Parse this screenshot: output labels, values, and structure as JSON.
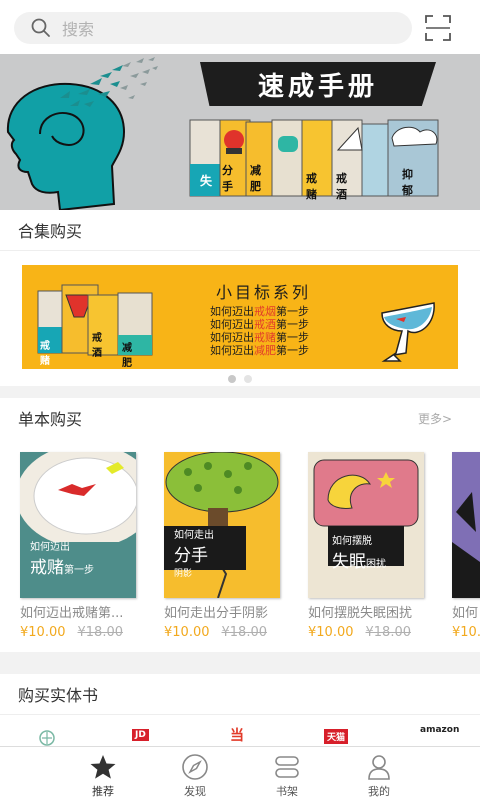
{
  "search": {
    "placeholder": "搜索",
    "icon": "search-icon"
  },
  "scan": {
    "icon": "scan-icon"
  },
  "hero": {
    "title": "速成手册",
    "book_labels": [
      "失",
      "分手",
      "减肥",
      "戒赌",
      "戒酒",
      "抑郁"
    ]
  },
  "collection": {
    "header": "合集购买",
    "banner": {
      "series_title": "小目标系列",
      "lines": [
        {
          "a": "如何迈出",
          "hl": "戒烟",
          "b": "第一步"
        },
        {
          "a": "如何迈出",
          "hl": "戒酒",
          "b": "第一步"
        },
        {
          "a": "如何迈出",
          "hl": "戒赌",
          "b": "第一步"
        },
        {
          "a": "如何迈出",
          "hl": "减肥",
          "b": "第一步"
        }
      ],
      "mini_books": [
        "戒赌",
        "戒酒",
        "减肥"
      ]
    },
    "page_dots": 2,
    "active_dot": 0
  },
  "single": {
    "header": "单本购买",
    "more": "更多>",
    "books": [
      {
        "title": "如何迈出戒赌第一步",
        "display_title": "如何迈出戒赌第...",
        "cover_small": "如何迈出",
        "cover_big": "戒赌",
        "cover_suffix": "第一步",
        "price": "¥10.00",
        "original_price": "¥18.00"
      },
      {
        "title": "如何走出分手阴影",
        "display_title": "如何走出分手阴影",
        "cover_small": "如何走出",
        "cover_big": "分手",
        "cover_suffix": "阴影",
        "price": "¥10.00",
        "original_price": "¥18.00"
      },
      {
        "title": "如何摆脱失眠困扰",
        "display_title": "如何摆脱失眠困扰",
        "cover_small": "如何摆脱",
        "cover_big": "失眠",
        "cover_suffix": "困扰",
        "price": "¥10.00",
        "original_price": "¥18.00"
      },
      {
        "title": "如何",
        "display_title": "如何",
        "cover_small": "",
        "cover_big": "",
        "cover_suffix": "",
        "price": "¥10.",
        "original_price": ""
      }
    ]
  },
  "physical": {
    "header": "购买实体书",
    "stores": [
      "JD",
      "当",
      "天猫",
      "amazon"
    ]
  },
  "tabs": [
    {
      "label": "推荐",
      "icon": "star-icon",
      "active": true
    },
    {
      "label": "发现",
      "icon": "compass-icon",
      "active": false
    },
    {
      "label": "书架",
      "icon": "bookshelf-icon",
      "active": false
    },
    {
      "label": "我的",
      "icon": "user-icon",
      "active": false
    }
  ],
  "colors": {
    "accent_price": "#f2a91e",
    "banner_yellow": "#f8b417",
    "highlight_red": "#e23b2a",
    "hero_bg": "#c9cacb"
  }
}
